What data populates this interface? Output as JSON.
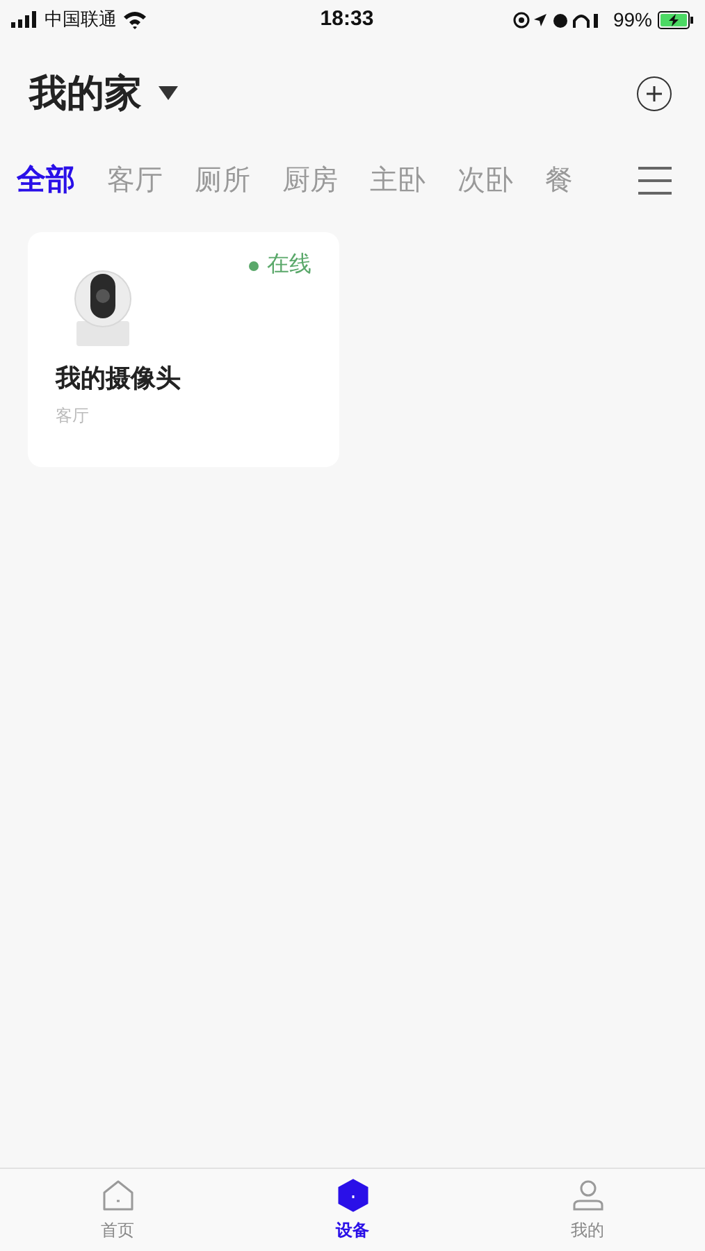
{
  "status_bar": {
    "carrier": "中国联通",
    "time": "18:33",
    "battery": "99%"
  },
  "header": {
    "title": "我的家"
  },
  "tabs": [
    {
      "label": "全部",
      "selected": true
    },
    {
      "label": "客厅",
      "selected": false
    },
    {
      "label": "厕所",
      "selected": false
    },
    {
      "label": "厨房",
      "selected": false
    },
    {
      "label": "主卧",
      "selected": false
    },
    {
      "label": "次卧",
      "selected": false
    },
    {
      "label": "餐",
      "selected": false
    }
  ],
  "devices": [
    {
      "name": "我的摄像头",
      "room": "客厅",
      "status": "在线",
      "color": "#5aa86a"
    }
  ],
  "nav": [
    {
      "label": "首页",
      "kind": "home",
      "selected": false
    },
    {
      "label": "设备",
      "kind": "device",
      "selected": true
    },
    {
      "label": "我的",
      "kind": "profile",
      "selected": false
    }
  ]
}
